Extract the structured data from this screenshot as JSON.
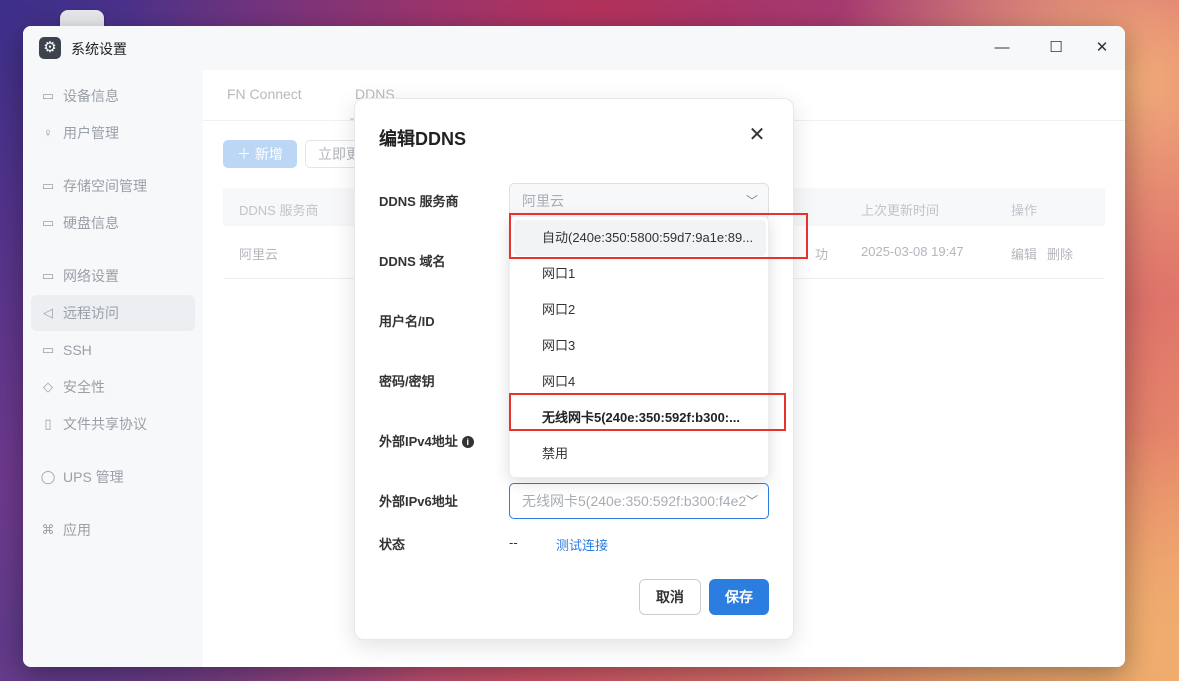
{
  "window": {
    "title": "系统设置",
    "minimize": "—",
    "maximize": "☐",
    "close": "✕"
  },
  "sidebar": {
    "items": [
      {
        "label": "设备信息",
        "icon": "▭"
      },
      {
        "label": "用户管理",
        "icon": "♀"
      },
      {
        "label": "存储空间管理",
        "icon": "▭"
      },
      {
        "label": "硬盘信息",
        "icon": "▭"
      },
      {
        "label": "网络设置",
        "icon": "▭"
      },
      {
        "label": "远程访问",
        "icon": "◁"
      },
      {
        "label": "SSH",
        "icon": "▭"
      },
      {
        "label": "安全性",
        "icon": "◇"
      },
      {
        "label": "文件共享协议",
        "icon": "▯"
      },
      {
        "label": "UPS 管理",
        "icon": "◯"
      },
      {
        "label": "应用",
        "icon": "⌘"
      }
    ]
  },
  "tabs": [
    "FN Connect",
    "DDNS"
  ],
  "toolbar": {
    "new_label": "＋ 新增",
    "update_label": "立即更"
  },
  "table": {
    "headers": [
      "DDNS 服务商",
      "上次更新时间",
      "操作"
    ],
    "row": {
      "provider": "阿里云",
      "status_tail": "功",
      "updated": "2025-03-08 19:47",
      "edit": "编辑",
      "delete": "删除"
    }
  },
  "dialog": {
    "title": "编辑DDNS",
    "labels": {
      "provider": "DDNS 服务商",
      "domain": "DDNS 域名",
      "username": "用户名/ID",
      "password": "密码/密钥",
      "ipv4": "外部IPv4地址",
      "ipv6": "外部IPv6地址",
      "status": "状态"
    },
    "provider_value": "阿里云",
    "ipv6_value": "无线网卡5(240e:350:592f:b300:f4e2",
    "status_value": "--",
    "test_link": "测试连接",
    "cancel": "取消",
    "save": "保存"
  },
  "dropdown": {
    "options": [
      "自动(240e:350:5800:59d7:9a1e:89...",
      "网口1",
      "网口2",
      "网口3",
      "网口4",
      "无线网卡5(240e:350:592f:b300:...",
      "禁用"
    ]
  },
  "colors": {
    "accent": "#2b7de0",
    "highlight": "#e8322c"
  }
}
